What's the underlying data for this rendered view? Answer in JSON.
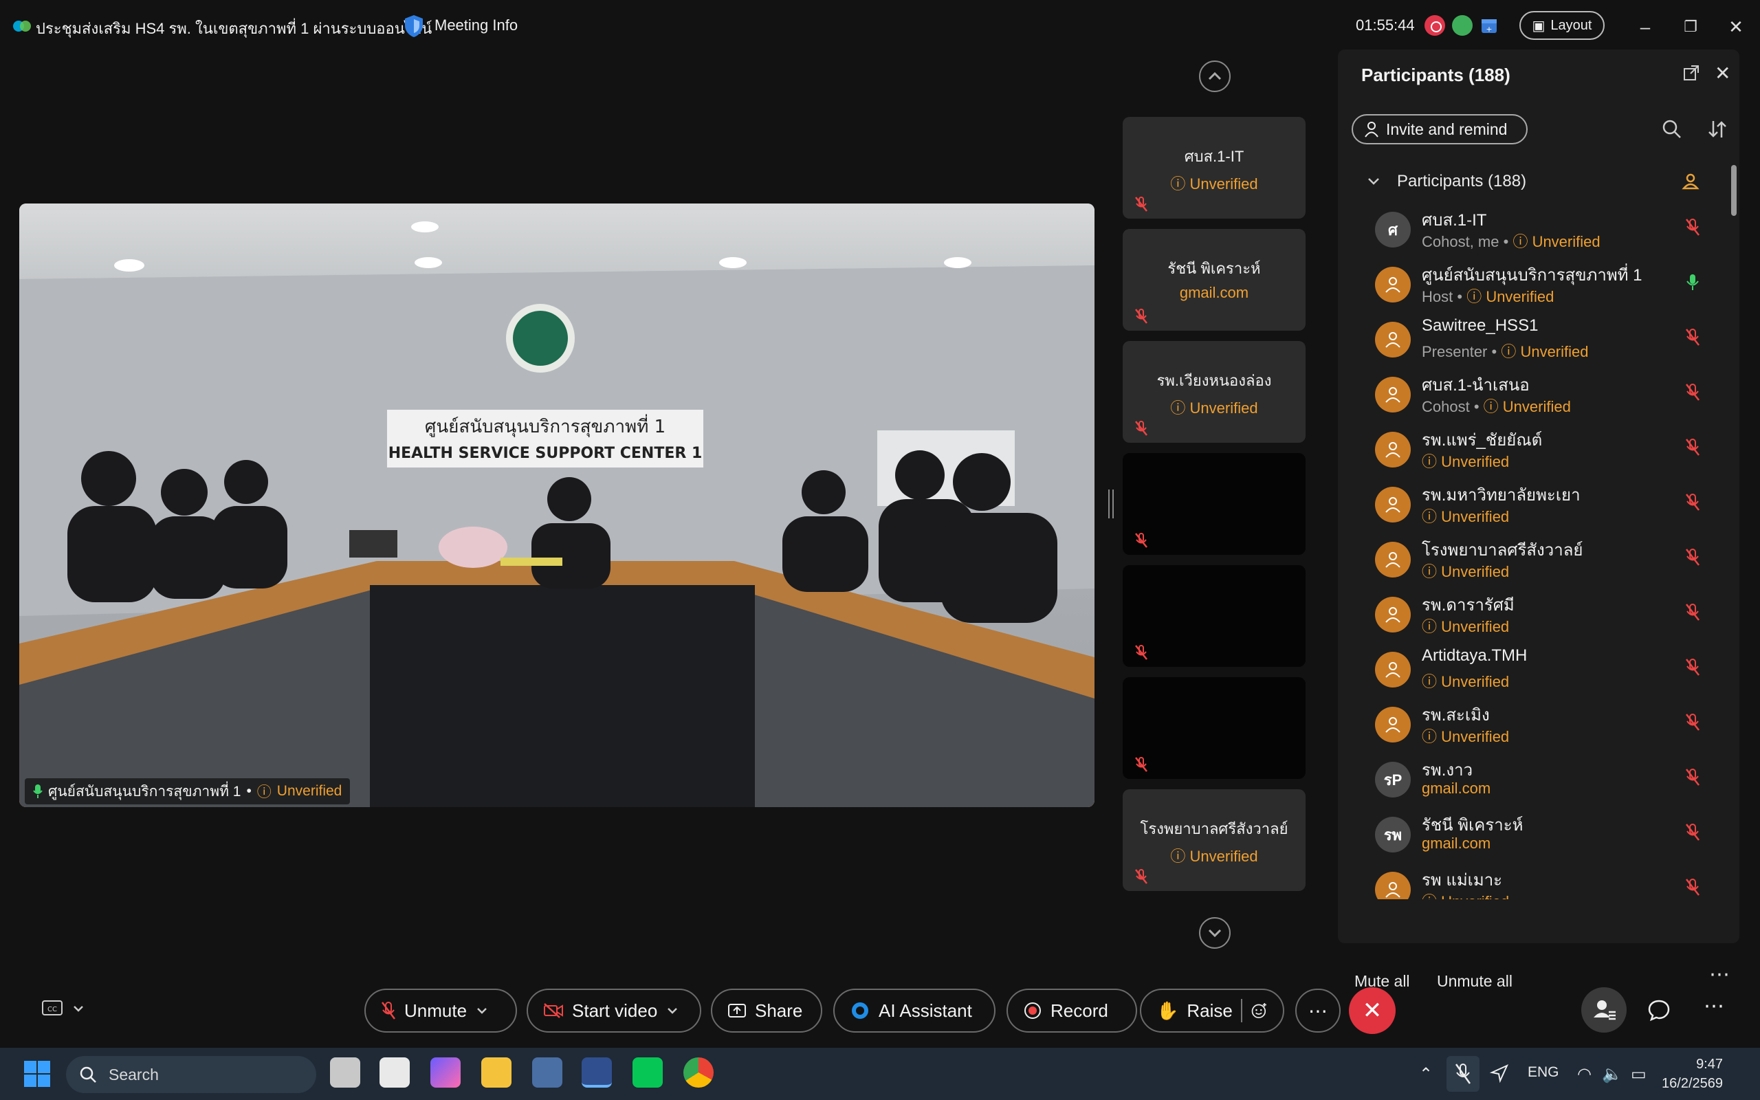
{
  "titlebar": {
    "meeting_title": "ประชุมส่งเสริม HS4 รพ. ในเขตสุขภาพที่ 1 ผ่านระบบออนไลน์",
    "meeting_info": "Meeting Info",
    "elapsed": "01:55:44",
    "layout": "Layout"
  },
  "main_video": {
    "name": "ศูนย์สนับสนุนบริการสุขภาพที่ 1",
    "sep": "•",
    "status": "Unverified",
    "sign_th": "ศูนย์สนับสนุนบริการสุขภาพที่ 1",
    "sign_en": "HEALTH SERVICE SUPPORT CENTER 1"
  },
  "thumbnails": [
    {
      "name": "ศบส.1-IT",
      "sub": "Unverified",
      "sub_type": "unverified"
    },
    {
      "name": "รัชนี พิเคราะห์",
      "sub": "gmail.com",
      "sub_type": "email"
    },
    {
      "name": "รพ.เวียงหนองล่อง",
      "sub": "Unverified",
      "sub_type": "unverified"
    },
    {
      "name": "",
      "sub": "",
      "sub_type": "none"
    },
    {
      "name": "",
      "sub": "",
      "sub_type": "none"
    },
    {
      "name": "",
      "sub": "",
      "sub_type": "none"
    },
    {
      "name": "โรงพยาบาลศรีสังวาลย์",
      "sub": "Unverified",
      "sub_type": "unverified"
    }
  ],
  "panel": {
    "title": "Participants (188)",
    "invite": "Invite and remind",
    "group": "Participants (188)",
    "participants": [
      {
        "initial": "ศ",
        "name": "ศบส.1-IT",
        "role": "Cohost, me",
        "status": "Unverified",
        "mic": "muted",
        "avatar": "gray"
      },
      {
        "initial": "",
        "name": "ศูนย์สนับสนุนบริการสุขภาพที่ 1",
        "role": "Host",
        "status": "Unverified",
        "mic": "on",
        "avatar": "orange"
      },
      {
        "initial": "",
        "name": "Sawitree_HSS1",
        "role": "Presenter",
        "status": "Unverified",
        "mic": "muted",
        "avatar": "orange"
      },
      {
        "initial": "",
        "name": "ศบส.1-นำเสนอ",
        "role": "Cohost",
        "status": "Unverified",
        "mic": "muted",
        "avatar": "orange"
      },
      {
        "initial": "",
        "name": "รพ.แพร่_ชัยยัณต์",
        "role": "",
        "status": "Unverified",
        "mic": "muted",
        "avatar": "orange"
      },
      {
        "initial": "",
        "name": "รพ.มหาวิทยาลัยพะเยา",
        "role": "",
        "status": "Unverified",
        "mic": "muted",
        "avatar": "orange"
      },
      {
        "initial": "",
        "name": "โรงพยาบาลศรีสังวาลย์",
        "role": "",
        "status": "Unverified",
        "mic": "muted",
        "avatar": "orange"
      },
      {
        "initial": "",
        "name": "รพ.ดารารัศมี",
        "role": "",
        "status": "Unverified",
        "mic": "muted",
        "avatar": "orange"
      },
      {
        "initial": "",
        "name": "Artidtaya.TMH",
        "role": "",
        "status": "Unverified",
        "mic": "muted",
        "avatar": "orange"
      },
      {
        "initial": "",
        "name": "รพ.สะเมิง",
        "role": "",
        "status": "Unverified",
        "mic": "muted",
        "avatar": "orange"
      },
      {
        "initial": "รP",
        "name": "รพ.งาว",
        "role": "",
        "status": "gmail.com",
        "mic": "muted",
        "avatar": "gray"
      },
      {
        "initial": "รพ",
        "name": "รัชนี พิเคราะห์",
        "role": "",
        "status": "gmail.com",
        "mic": "muted",
        "avatar": "gray"
      },
      {
        "initial": "",
        "name": "รพ แม่เมาะ",
        "role": "",
        "status": "Unverified",
        "mic": "muted",
        "avatar": "orange"
      }
    ],
    "mute_all": "Mute all",
    "unmute_all": "Unmute all"
  },
  "controls": {
    "unmute": "Unmute",
    "start_video": "Start video",
    "share": "Share",
    "ai_assistant": "AI Assistant",
    "record": "Record",
    "raise": "Raise"
  },
  "taskbar": {
    "search": "Search",
    "lang": "ENG",
    "time": "9:47",
    "date": "16/2/2569"
  },
  "colors": {
    "unverified": "#f0a030",
    "end": "#e0333f",
    "accent": "#1a73e8"
  }
}
